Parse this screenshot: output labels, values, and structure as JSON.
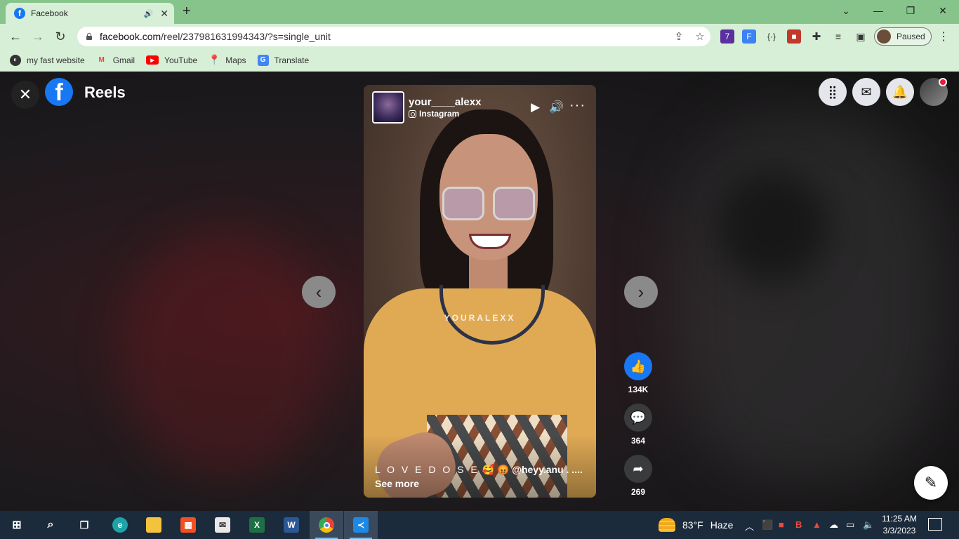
{
  "browser": {
    "tab_title": "Facebook",
    "tab_favicon": "f",
    "url_host": "facebook.com",
    "url_path": "/reel/237981631994343/?s=single_unit",
    "profile_label": "Paused",
    "extension_badge": "7"
  },
  "bookmarks": [
    {
      "label": "my fast website",
      "icon": "globe-icon",
      "color": "#333333"
    },
    {
      "label": "Gmail",
      "icon": "gmail-icon",
      "color": "#ea4335"
    },
    {
      "label": "YouTube",
      "icon": "youtube-icon",
      "color": "#ff0000"
    },
    {
      "label": "Maps",
      "icon": "maps-icon",
      "color": "#34a853"
    },
    {
      "label": "Translate",
      "icon": "translate-icon",
      "color": "#4285f4"
    }
  ],
  "facebook": {
    "section_title": "Reels",
    "brand_color": "#1877f2"
  },
  "reel": {
    "username": "your____alexx",
    "source": "Instagram",
    "watermark": "YOURALEXX",
    "caption_lovedose": "L O V E D O S E",
    "caption_emoji1": "🥰",
    "caption_emoji2": "😡",
    "caption_rest": "@heyy.anu . .... See more"
  },
  "actions": {
    "likes": "134K",
    "comments": "364",
    "shares": "269"
  },
  "taskbar": {
    "weather_temp": "83°F",
    "weather_desc": "Haze",
    "time": "11:25 AM",
    "date": "3/3/2023"
  }
}
